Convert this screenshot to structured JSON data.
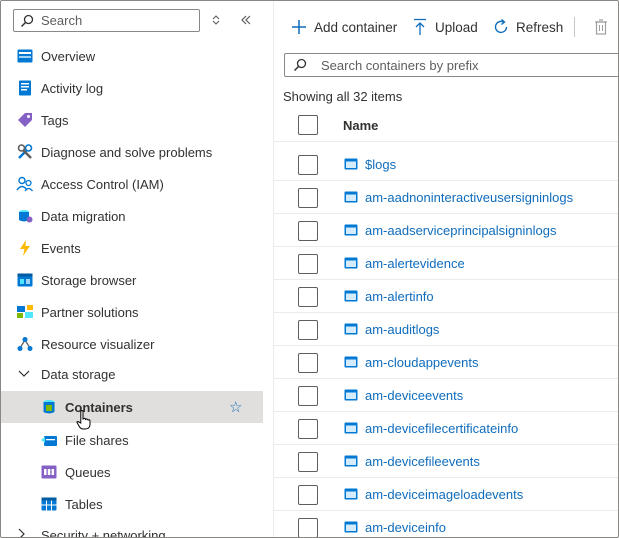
{
  "sidebar": {
    "search_placeholder": "Search",
    "items": [
      {
        "label": "Overview",
        "icon": "overview-icon"
      },
      {
        "label": "Activity log",
        "icon": "activity-log-icon"
      },
      {
        "label": "Tags",
        "icon": "tag-icon"
      },
      {
        "label": "Diagnose and solve problems",
        "icon": "wrench-icon"
      },
      {
        "label": "Access Control (IAM)",
        "icon": "people-icon"
      },
      {
        "label": "Data migration",
        "icon": "data-migration-icon"
      },
      {
        "label": "Events",
        "icon": "lightning-icon"
      },
      {
        "label": "Storage browser",
        "icon": "storage-browser-icon"
      },
      {
        "label": "Partner solutions",
        "icon": "partner-icon"
      },
      {
        "label": "Resource visualizer",
        "icon": "visualizer-icon"
      }
    ],
    "group_data_storage": "Data storage",
    "sub_items": [
      {
        "label": "Containers",
        "icon": "container-icon",
        "selected": true
      },
      {
        "label": "File shares",
        "icon": "file-share-icon"
      },
      {
        "label": "Queues",
        "icon": "queue-icon"
      },
      {
        "label": "Tables",
        "icon": "table-icon"
      }
    ],
    "group_security": "Security + networking"
  },
  "toolbar": {
    "add_container": "Add container",
    "upload": "Upload",
    "refresh": "Refresh"
  },
  "list": {
    "search_placeholder": "Search containers by prefix",
    "count_text": "Showing all 32 items",
    "column_name": "Name",
    "rows": [
      "$logs",
      "am-aadnoninteractiveusersigninlogs",
      "am-aadserviceprincipalsigninlogs",
      "am-alertevidence",
      "am-alertinfo",
      "am-auditlogs",
      "am-cloudappevents",
      "am-deviceevents",
      "am-devicefilecertificateinfo",
      "am-devicefileevents",
      "am-deviceimageloadevents",
      "am-deviceinfo"
    ]
  },
  "colors": {
    "accent": "#0f6cbd",
    "selected_bg": "#e1dfdd"
  }
}
